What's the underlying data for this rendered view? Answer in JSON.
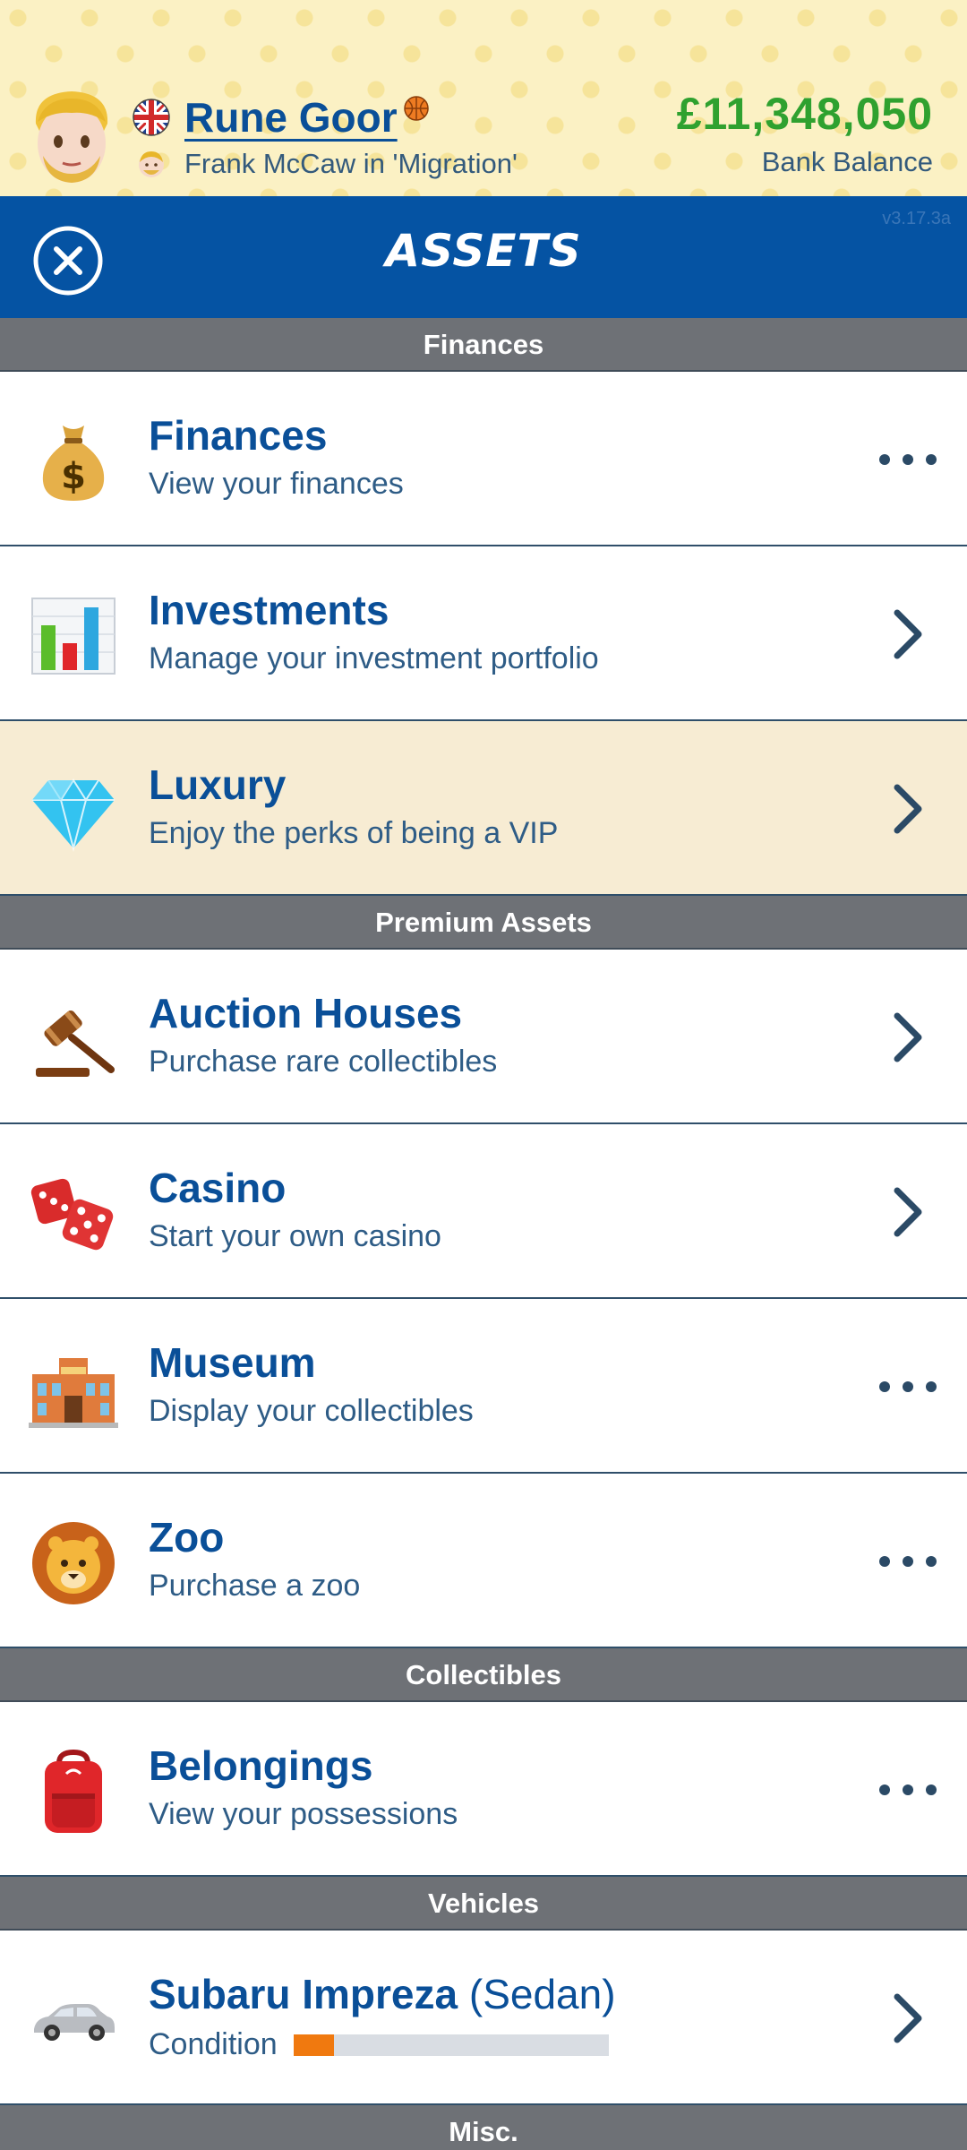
{
  "profile": {
    "name": "Rune Goor",
    "relation": "Frank McCaw in 'Migration'",
    "balance": "£11,348,050",
    "balance_label": "Bank Balance"
  },
  "header": {
    "title": "ASSETS",
    "version": "v3.17.3a"
  },
  "sections": {
    "finances": "Finances",
    "premium": "Premium Assets",
    "collectibles": "Collectibles",
    "vehicles": "Vehicles",
    "misc": "Misc."
  },
  "rows": {
    "finances": {
      "title": "Finances",
      "desc": "View your finances",
      "icon": "money-bag-icon",
      "action": "more"
    },
    "investments": {
      "title": "Investments",
      "desc": "Manage your investment portfolio",
      "icon": "bar-chart-icon",
      "action": "chevron"
    },
    "luxury": {
      "title": "Luxury",
      "desc": "Enjoy the perks of being a VIP",
      "icon": "diamond-icon",
      "action": "chevron"
    },
    "auction": {
      "title": "Auction Houses",
      "desc": "Purchase rare collectibles",
      "icon": "gavel-icon",
      "action": "chevron"
    },
    "casino": {
      "title": "Casino",
      "desc": "Start your own casino",
      "icon": "dice-icon",
      "action": "chevron"
    },
    "museum": {
      "title": "Museum",
      "desc": "Display your collectibles",
      "icon": "museum-icon",
      "action": "more"
    },
    "zoo": {
      "title": "Zoo",
      "desc": "Purchase a zoo",
      "icon": "lion-icon",
      "action": "more"
    },
    "belongings": {
      "title": "Belongings",
      "desc": "View your possessions",
      "icon": "backpack-icon",
      "action": "more"
    },
    "vehicle": {
      "title": "Subaru Impreza",
      "type": "(Sedan)",
      "condition_label": "Condition",
      "condition": 0.13,
      "icon": "car-icon",
      "action": "chevron"
    }
  },
  "colors": {
    "title_bar": "#0553a3",
    "section_header": "#6e7176",
    "balance": "#2fa12f",
    "link": "#0a4f98",
    "highlight_row": "#f7ecd3",
    "condition_fill": "#f0790f"
  }
}
